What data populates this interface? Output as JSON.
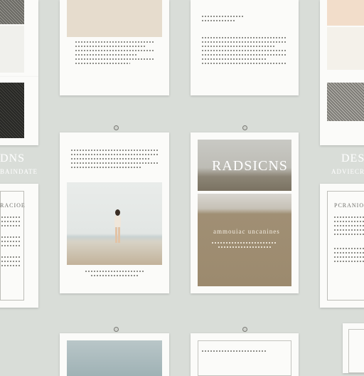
{
  "colors": {
    "background": "#d9ddd8",
    "card": "#fbfbf9",
    "sand": "#a08f74",
    "sea": "#c8d0d0",
    "beige_band": "#e6dccd",
    "peach": "#f2ddca",
    "text_gray": "#8d8d88"
  },
  "titles": {
    "radsicns": "RADSICNS",
    "sand_caption": "ammouiac uncanines",
    "left_des": "DNS",
    "left_sub": "BAINDATE",
    "right_des": "DES",
    "right_sub": "ADVIECR",
    "left_card_head": "RACIOE",
    "right_card_head": "PCRANIOE"
  }
}
